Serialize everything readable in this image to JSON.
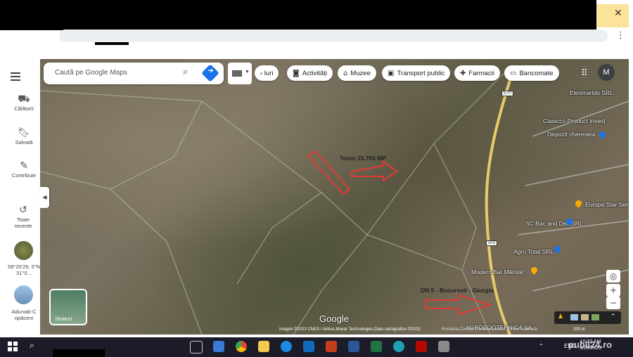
{
  "window": {
    "close_label": "✕",
    "menu_label": "⋮"
  },
  "sidebar": {
    "items": [
      {
        "label": "Călătorii",
        "icon": "car-icon"
      },
      {
        "label": "Salvată",
        "icon": "bookmark-icon"
      },
      {
        "label": "Contribuie",
        "icon": "edit-icon"
      },
      {
        "label": "Toate recente",
        "icon": "history-icon"
      }
    ],
    "recent": [
      {
        "label": "58°20'26. 5\"N 31°0..."
      },
      {
        "label": "Adunații-C opăceni"
      }
    ]
  },
  "search": {
    "placeholder": "Caută pe Google Maps"
  },
  "chips": [
    {
      "label": "‹ luri",
      "icon": ""
    },
    {
      "label": "Activități",
      "icon": "camera-icon"
    },
    {
      "label": "Muzee",
      "icon": "museum-icon"
    },
    {
      "label": "Transport public",
      "icon": "bus-icon"
    },
    {
      "label": "Farmacii",
      "icon": "pharmacy-icon"
    },
    {
      "label": "Bancomate",
      "icon": "atm-icon"
    }
  ],
  "account": {
    "initial": "M"
  },
  "map": {
    "pois": [
      {
        "label": "Eleomarido SRL"
      },
      {
        "label": "Clasicco Product Invest"
      },
      {
        "label": "Depozit cherestea"
      },
      {
        "label": "Europa Star Ser"
      },
      {
        "label": "SC Bac and Dec SRL"
      },
      {
        "label": "Agro Total SRL"
      },
      {
        "label": "Modern Bar MikiVal"
      },
      {
        "label": "AGROZOOTEHNICA SA"
      }
    ],
    "roads": [
      {
        "label": "E70"
      },
      {
        "label": "503"
      }
    ],
    "annotations": {
      "terrain": "Teren 15.783 MP",
      "road": "DN 5 - Bucuresti - Giurgiu"
    },
    "layers_label": "Straturi",
    "logo": "Google",
    "attribution": "Imagini ©2023 CNES / Airbus,Maxar Technologies,Date cartografice ©2023",
    "terms": "România    Condiții    Confidențialitate    Trimite feedback",
    "scale": "200 m",
    "zoom_in": "+",
    "zoom_out": "−"
  },
  "taskbar": {
    "time": "10:32 AM",
    "date": "3/28/2023",
    "lang": "ENG",
    "watermark": "publi24.ro"
  },
  "colors": {
    "annotation_red": "#e53935",
    "accent_blue": "#1a73e8",
    "taskbar_bg": "#1c1c28"
  }
}
